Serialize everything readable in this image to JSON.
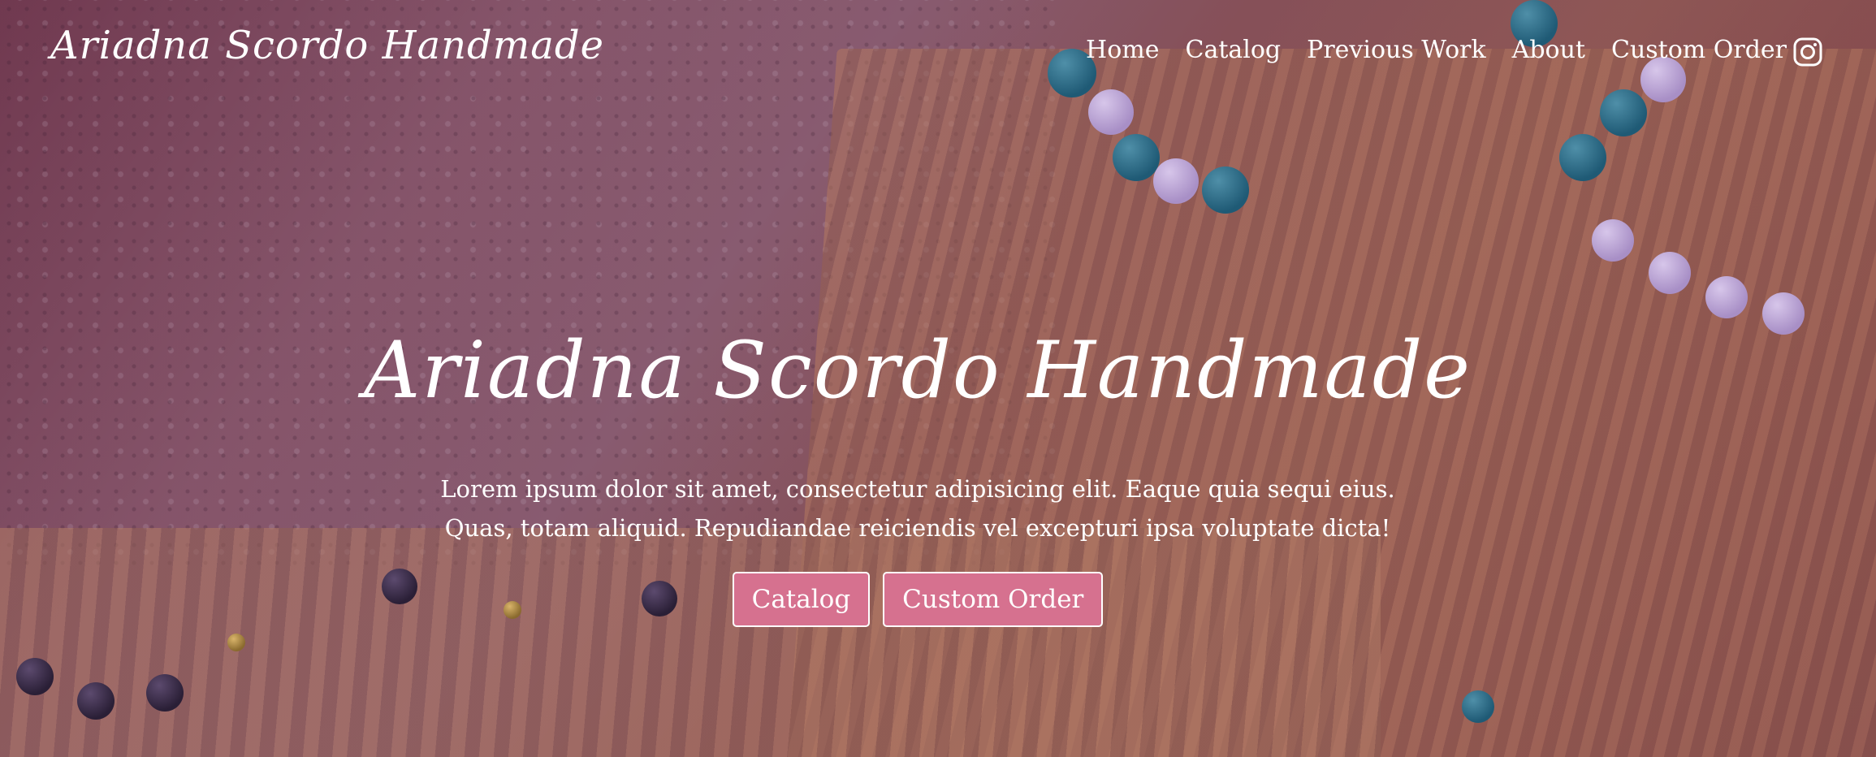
{
  "nav": {
    "brand": "Ariadna Scordo Handmade",
    "links": [
      "Home",
      "Catalog",
      "Previous Work",
      "About",
      "Custom Order"
    ],
    "social_icon": "instagram-icon"
  },
  "hero": {
    "title": "Ariadna Scordo Handmade",
    "text": "Lorem ipsum dolor sit amet, consectetur adipisicing elit. Eaque quia sequi eius. Quas, totam aliquid. Repudiandae reiciendis vel excepturi ipsa voluptate dicta!",
    "buttons": [
      "Catalog",
      "Custom Order"
    ]
  },
  "colors": {
    "overlay": "#7a3755",
    "button_bg": "#d6718f",
    "text": "#ffffff"
  }
}
